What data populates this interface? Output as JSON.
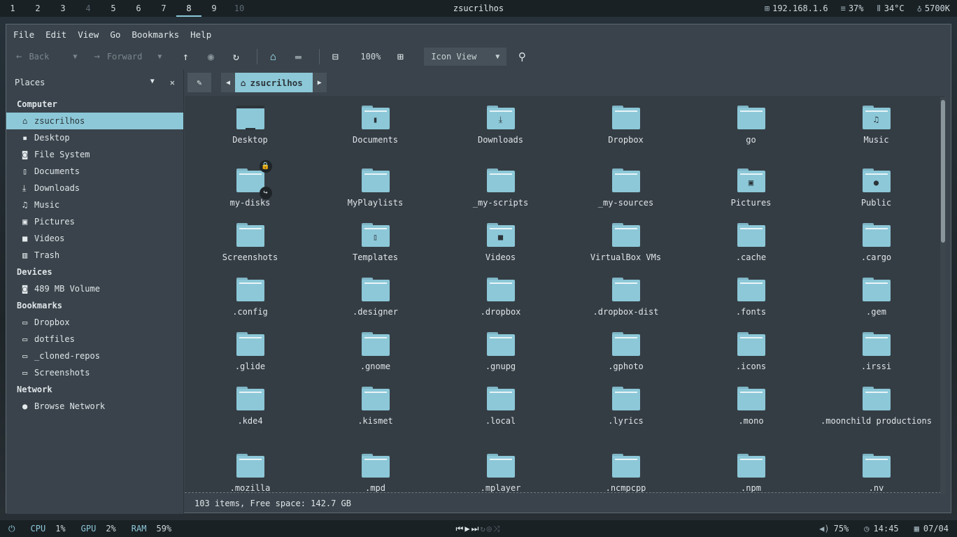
{
  "topbar": {
    "workspaces": [
      "1",
      "2",
      "3",
      "4",
      "5",
      "6",
      "7",
      "8",
      "9",
      "10"
    ],
    "active_workspace": "8",
    "title": "zsucrilhos",
    "ip": "192.168.1.6",
    "disk": "37%",
    "temp": "34°C",
    "color_temp": "5700K"
  },
  "menu": [
    "File",
    "Edit",
    "View",
    "Go",
    "Bookmarks",
    "Help"
  ],
  "toolbar": {
    "back": "Back",
    "forward": "Forward",
    "zoom": "100%",
    "view_mode": "Icon View"
  },
  "sidebar": {
    "header": "Places",
    "sections": [
      {
        "title": "Computer",
        "items": [
          {
            "label": "zsucrilhos",
            "icon": "home-icon",
            "glyph": "⌂",
            "selected": true
          },
          {
            "label": "Desktop",
            "icon": "desktop-icon",
            "glyph": "▪"
          },
          {
            "label": "File System",
            "icon": "drive-icon",
            "glyph": "◙"
          },
          {
            "label": "Documents",
            "icon": "document-icon",
            "glyph": "▯"
          },
          {
            "label": "Downloads",
            "icon": "download-icon",
            "glyph": "⤓"
          },
          {
            "label": "Music",
            "icon": "music-icon",
            "glyph": "♫"
          },
          {
            "label": "Pictures",
            "icon": "picture-icon",
            "glyph": "▣"
          },
          {
            "label": "Videos",
            "icon": "video-icon",
            "glyph": "■"
          },
          {
            "label": "Trash",
            "icon": "trash-icon",
            "glyph": "▥"
          }
        ]
      },
      {
        "title": "Devices",
        "items": [
          {
            "label": "489 MB Volume",
            "icon": "drive-icon",
            "glyph": "◙"
          }
        ]
      },
      {
        "title": "Bookmarks",
        "items": [
          {
            "label": "Dropbox",
            "icon": "folder-icon",
            "glyph": "▭"
          },
          {
            "label": "dotfiles",
            "icon": "folder-icon",
            "glyph": "▭"
          },
          {
            "label": "_cloned-repos",
            "icon": "folder-icon",
            "glyph": "▭"
          },
          {
            "label": "Screenshots",
            "icon": "folder-icon",
            "glyph": "▭"
          }
        ]
      },
      {
        "title": "Network",
        "items": [
          {
            "label": "Browse Network",
            "icon": "globe-icon",
            "glyph": "●"
          }
        ]
      }
    ]
  },
  "pathbar": {
    "crumb": "zsucrilhos"
  },
  "files": [
    [
      {
        "name": "Desktop",
        "kind": "desktop"
      },
      {
        "name": "Documents",
        "glyph": "▮"
      },
      {
        "name": "Downloads",
        "glyph": "⤓"
      },
      {
        "name": "Dropbox"
      },
      {
        "name": "go"
      },
      {
        "name": "Music",
        "glyph": "♫"
      }
    ],
    [
      {
        "name": "my-disks",
        "emblems": true
      },
      {
        "name": "MyPlaylists"
      },
      {
        "name": "_my-scripts"
      },
      {
        "name": "_my-sources"
      },
      {
        "name": "Pictures",
        "glyph": "▣"
      },
      {
        "name": "Public",
        "glyph": "●"
      }
    ],
    [
      {
        "name": "Screenshots"
      },
      {
        "name": "Templates",
        "glyph": "▯"
      },
      {
        "name": "Videos",
        "glyph": "■"
      },
      {
        "name": "VirtualBox VMs"
      },
      {
        "name": ".cache"
      },
      {
        "name": ".cargo"
      }
    ],
    [
      {
        "name": ".config"
      },
      {
        "name": ".designer"
      },
      {
        "name": ".dropbox"
      },
      {
        "name": ".dropbox-dist"
      },
      {
        "name": ".fonts"
      },
      {
        "name": ".gem"
      }
    ],
    [
      {
        "name": ".glide"
      },
      {
        "name": ".gnome"
      },
      {
        "name": ".gnupg"
      },
      {
        "name": ".gphoto"
      },
      {
        "name": ".icons"
      },
      {
        "name": ".irssi"
      }
    ],
    [
      {
        "name": ".kde4"
      },
      {
        "name": ".kismet"
      },
      {
        "name": ".local"
      },
      {
        "name": ".lyrics"
      },
      {
        "name": ".mono"
      },
      {
        "name": ".moonchild productions"
      }
    ],
    [
      {
        "name": ".mozilla"
      },
      {
        "name": ".mpd"
      },
      {
        "name": ".mplayer"
      },
      {
        "name": ".ncmpcpp"
      },
      {
        "name": ".npm"
      },
      {
        "name": ".nv"
      }
    ]
  ],
  "status": "103 items, Free space: 142.7 GB",
  "bottombar": {
    "cpu_label": "CPU",
    "cpu": "1%",
    "gpu_label": "GPU",
    "gpu": "2%",
    "ram_label": "RAM",
    "ram": "59%",
    "volume": "75%",
    "time": "14:45",
    "date": "07/04"
  }
}
